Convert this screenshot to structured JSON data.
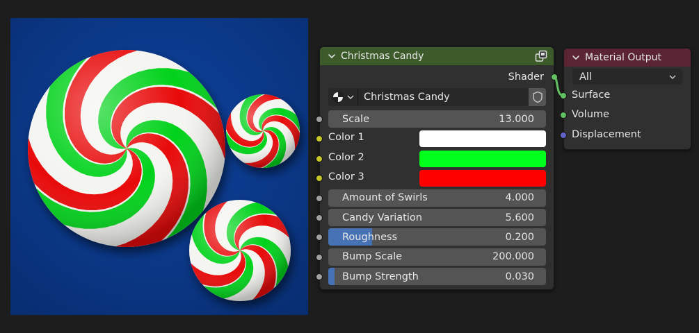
{
  "group_node": {
    "title": "Christmas Candy",
    "header_color": "#3c5a2a",
    "output_label": "Shader",
    "group_datablock": "Christmas Candy",
    "inputs": [
      {
        "label": "Scale",
        "value": "13.000",
        "socket": "gray"
      },
      {
        "label": "Color 1",
        "swatch": "#ffffff",
        "socket": "yellow"
      },
      {
        "label": "Color 2",
        "swatch": "#00ff1a",
        "socket": "yellow"
      },
      {
        "label": "Color 3",
        "swatch": "#ff0000",
        "socket": "yellow"
      },
      {
        "label": "Amount of Swirls",
        "value": "4.000",
        "socket": "gray"
      },
      {
        "label": "Candy Variation",
        "value": "5.600",
        "socket": "gray"
      },
      {
        "label": "Roughness",
        "value": "0.200",
        "socket": "gray",
        "fill_fraction": 0.2
      },
      {
        "label": "Bump Scale",
        "value": "200.000",
        "socket": "gray"
      },
      {
        "label": "Bump Strength",
        "value": "0.030",
        "socket": "gray",
        "fill_fraction": 0.03
      }
    ]
  },
  "output_node": {
    "title": "Material Output",
    "header_color": "#5a2433",
    "target": "All",
    "inputs": [
      "Surface",
      "Volume",
      "Displacement"
    ]
  },
  "render": {
    "background_color": "#0b3a8e",
    "stripe_colors": [
      "#ffffff",
      "#00d21a",
      "#e80a0a"
    ]
  }
}
